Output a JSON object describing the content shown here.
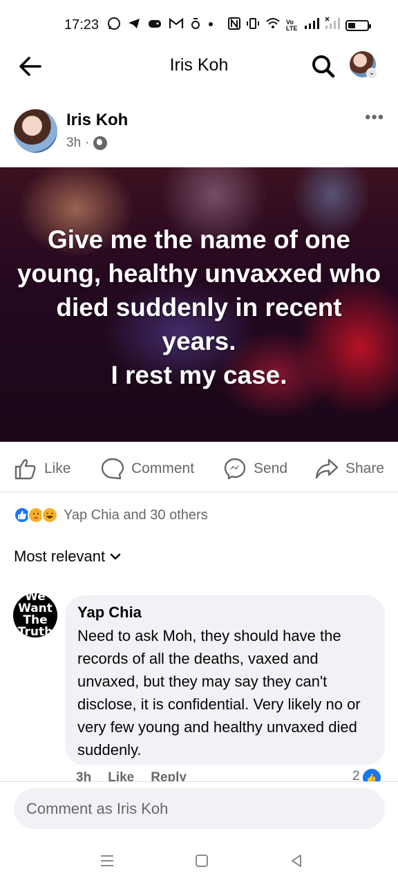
{
  "status_bar": {
    "time": "17:23",
    "left_icons": [
      "whatsapp-icon",
      "telegram-icon",
      "game-icon",
      "gmail-icon",
      "app-icon",
      "dot-icon"
    ],
    "right_icons": [
      "nfc-icon",
      "vibrate-icon",
      "wifi-icon",
      "volte-icon",
      "signal-icon",
      "signal-x-icon",
      "battery-icon"
    ],
    "volte_label": "Vo LTE"
  },
  "header": {
    "title": "Iris Koh",
    "back_icon": "arrow-left-icon",
    "search_icon": "search-icon"
  },
  "post": {
    "author": "Iris Koh",
    "time": "3h",
    "separator": "·",
    "privacy_icon": "globe-icon",
    "more_label": "•••",
    "image_text": "Give me the name of one young, healthy unvaxxed who died suddenly in recent years.",
    "image_text_2": "I rest my case."
  },
  "actions": {
    "like": "Like",
    "comment": "Comment",
    "send": "Send",
    "share": "Share"
  },
  "reactions": {
    "summary": "Yap Chia and 30 others",
    "types": [
      "like",
      "care",
      "haha"
    ]
  },
  "sort": {
    "label": "Most relevant"
  },
  "comment": {
    "avatar_text": [
      "We",
      "Want",
      "The",
      "Truth"
    ],
    "author": "Yap Chia",
    "text": "Need to ask Moh, they should have the records of all the deaths, vaxed and unvaxed, but they may say they can't disclose, it is confidential. Very likely no or very few young and healthy unvaxed died suddenly.",
    "time": "3h",
    "like_label": "Like",
    "reply_label": "Reply",
    "reaction_count": "2"
  },
  "comment_input": {
    "placeholder": "Comment as Iris Koh"
  },
  "system_nav": [
    "menu-icon",
    "home-icon",
    "back-triangle-icon"
  ]
}
